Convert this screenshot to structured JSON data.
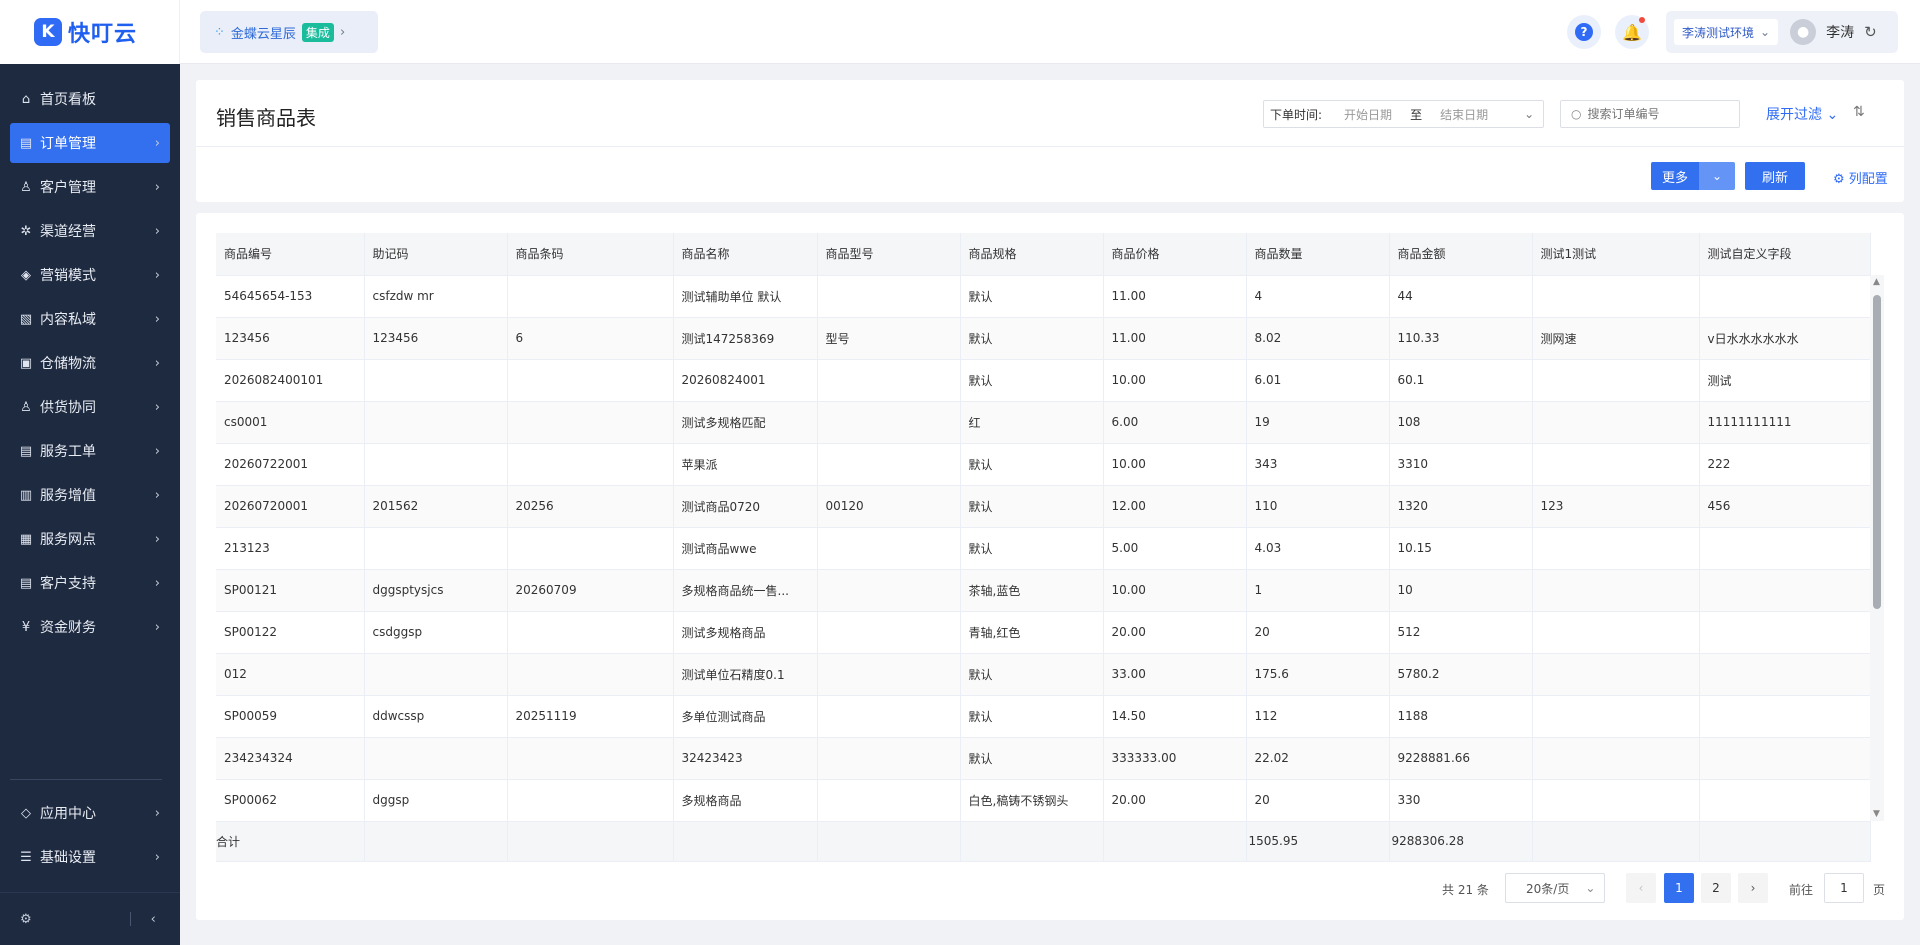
{
  "logo": {
    "mark": "K",
    "text": "快叮云"
  },
  "sidebar": {
    "items": [
      {
        "icon": "⌂",
        "label": "首页看板",
        "chevron": ""
      },
      {
        "icon": "▤",
        "label": "订单管理",
        "chevron": "›"
      },
      {
        "icon": "♙",
        "label": "客户管理",
        "chevron": "›"
      },
      {
        "icon": "✲",
        "label": "渠道经营",
        "chevron": "›"
      },
      {
        "icon": "◈",
        "label": "营销模式",
        "chevron": "›"
      },
      {
        "icon": "▧",
        "label": "内容私域",
        "chevron": "›"
      },
      {
        "icon": "▣",
        "label": "仓储物流",
        "chevron": "›"
      },
      {
        "icon": "♙",
        "label": "供货协同",
        "chevron": "›"
      },
      {
        "icon": "▤",
        "label": "服务工单",
        "chevron": "›"
      },
      {
        "icon": "▥",
        "label": "服务增值",
        "chevron": "›"
      },
      {
        "icon": "▦",
        "label": "服务网点",
        "chevron": "›"
      },
      {
        "icon": "▤",
        "label": "客户支持",
        "chevron": "›"
      },
      {
        "icon": "¥",
        "label": "资金财务",
        "chevron": "›"
      }
    ],
    "bottom_items": [
      {
        "icon": "◇",
        "label": "应用中心",
        "chevron": "›"
      },
      {
        "icon": "☰",
        "label": "基础设置",
        "chevron": "›"
      }
    ],
    "footer": {
      "gear": "⚙",
      "collapse": "‹"
    }
  },
  "header": {
    "brand": {
      "dots": "⁘",
      "name": "金蝶云星辰",
      "tag": "集成",
      "arrow": "›"
    },
    "help": "?",
    "bell": "🔔",
    "env": {
      "label": "李涛测试环境",
      "chevron": "⌄",
      "avatar": "●",
      "user": "李涛",
      "refresh": "↻"
    }
  },
  "page": {
    "title": "销售商品表",
    "date_filter": {
      "label": "下单时间:",
      "start_placeholder": "开始日期",
      "separator": "至",
      "end_placeholder": "结束日期",
      "calendar": "⌄"
    },
    "search": {
      "icon": "○",
      "placeholder": "搜索订单编号"
    },
    "expand_filter": "展开过滤 ⌄",
    "sort_icon": "⇅",
    "buttons": {
      "more": "更多",
      "more_dropdown": "⌄",
      "refresh": "刷新",
      "column_config": "⚙ 列配置"
    }
  },
  "table": {
    "columns": [
      "商品编号",
      "助记码",
      "商品条码",
      "商品名称",
      "商品型号",
      "商品规格",
      "商品价格",
      "商品数量",
      "商品金额",
      "测试1测试",
      "测试自定义字段"
    ],
    "rows": [
      [
        "54645654-153",
        "csfzdw mr",
        "",
        "测试辅助单位 默认",
        "",
        "默认",
        "11.00",
        "4",
        "44",
        "",
        ""
      ],
      [
        "123456",
        "123456",
        "6",
        "测试147258369",
        "型号",
        "默认",
        "11.00",
        "8.02",
        "110.33",
        "测网速",
        "v日水水水水水水"
      ],
      [
        "2026082400101",
        "",
        "",
        "20260824001",
        "",
        "默认",
        "10.00",
        "6.01",
        "60.1",
        "",
        "测试"
      ],
      [
        "cs0001",
        "",
        "",
        "测试多规格匹配",
        "",
        "红",
        "6.00",
        "19",
        "108",
        "",
        "11111111111"
      ],
      [
        "20260722001",
        "",
        "",
        "苹果派",
        "",
        "默认",
        "10.00",
        "343",
        "3310",
        "",
        "222"
      ],
      [
        "20260720001",
        "201562",
        "20256",
        "测试商品0720",
        "00120",
        "默认",
        "12.00",
        "110",
        "1320",
        "123",
        "456"
      ],
      [
        "213123",
        "",
        "",
        "测试商品wwe",
        "",
        "默认",
        "5.00",
        "4.03",
        "10.15",
        "",
        ""
      ],
      [
        "SP00121",
        "dggsptysjcs",
        "20260709",
        "多规格商品统一售...",
        "",
        "茶轴,蓝色",
        "10.00",
        "1",
        "10",
        "",
        ""
      ],
      [
        "SP00122",
        "csdggsp",
        "",
        "测试多规格商品",
        "",
        "青轴,红色",
        "20.00",
        "20",
        "512",
        "",
        ""
      ],
      [
        "012",
        "",
        "",
        "测试单位石精度0.1",
        "",
        "默认",
        "33.00",
        "175.6",
        "5780.2",
        "",
        ""
      ],
      [
        "SP00059",
        "ddwcssp",
        "20251119",
        "多单位测试商品",
        "",
        "默认",
        "14.50",
        "112",
        "1188",
        "",
        ""
      ],
      [
        "234234324",
        "",
        "",
        "32423423",
        "",
        "默认",
        "333333.00",
        "22.02",
        "9228881.66",
        "",
        ""
      ],
      [
        "SP00062",
        "dggsp",
        "",
        "多规格商品",
        "",
        "白色,稿铸不锈钢头",
        "20.00",
        "20",
        "330",
        "",
        ""
      ]
    ],
    "total": {
      "label": "合计",
      "quantity": "1505.95",
      "amount": "9288306.28"
    },
    "scroll": {
      "up": "▲",
      "down": "▼"
    }
  },
  "pagination": {
    "total_text": "共 21 条",
    "page_size": "20条/页",
    "page_size_chevron": "⌄",
    "prev": "‹",
    "pages": [
      "1",
      "2"
    ],
    "next": "›",
    "goto_label": "前往",
    "goto_value": "1",
    "goto_suffix": "页"
  }
}
